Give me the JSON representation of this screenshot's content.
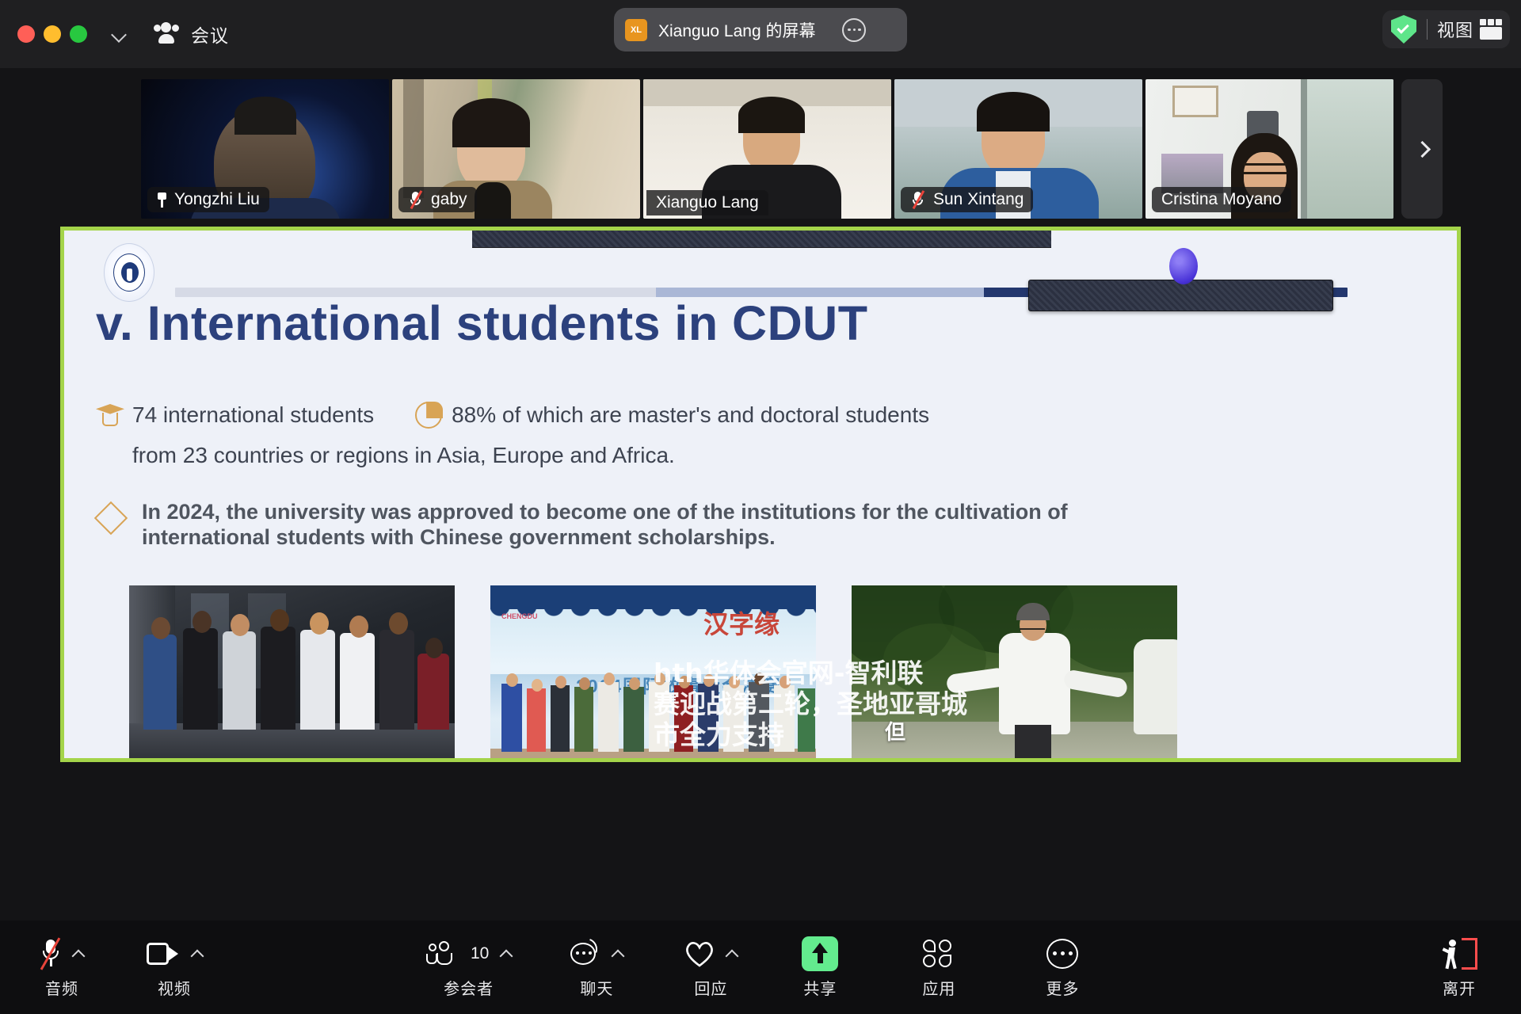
{
  "window": {
    "traffic_lights": [
      "close",
      "minimize",
      "maximize"
    ],
    "meeting_label": "会议",
    "chevron_icon": "chevron-down-icon",
    "participants_icon": "people-icon"
  },
  "share_banner": {
    "avatar_initials": "XL",
    "title": "Xianguo Lang 的屏幕",
    "more_icon": "ellipsis-circle-icon"
  },
  "top_right": {
    "security_icon": "shield-check-icon",
    "view_label": "视图",
    "layout_icon": "grid-layout-icon"
  },
  "filmstrip": {
    "next_icon": "chevron-right-icon",
    "participants": [
      {
        "name": "Yongzhi Liu",
        "status_icon": "pin-icon",
        "active": false
      },
      {
        "name": "gaby",
        "status_icon": "mic-muted-icon",
        "active": false
      },
      {
        "name": "Xianguo Lang",
        "status_icon": "none",
        "active": true
      },
      {
        "name": "Sun Xintang",
        "status_icon": "mic-muted-icon",
        "active": false
      },
      {
        "name": "Cristina Moyano",
        "status_icon": "none",
        "active": false
      }
    ]
  },
  "slide": {
    "title": "v. International students in CDUT",
    "stat_students_icon": "graduation-cap-icon",
    "stat_students": "74 international students",
    "stat_percent_icon": "pie-chart-icon",
    "stat_percent": "88% of which are  master's and doctoral students",
    "stat_line2": "from 23 countries or regions in Asia, Europe and Africa.",
    "paragraph_icon": "diamond-icon",
    "paragraph": "In 2024, the university was approved to become one of the institutions for the cultivation of international students  with Chinese government scholarships.",
    "logo_alt": "cdut-university-logo",
    "photo_captions": {
      "photo2_headline": "2024国际故事大会决赛",
      "photo2_calligraphy": "汉字缘",
      "photo2_city": "CHENGDU",
      "photo3_caption": "但"
    },
    "colors": {
      "title": "#2c417d",
      "accent": "#d8a456",
      "frame": "#a4d44a",
      "background": "#eef1f8"
    }
  },
  "watermark": {
    "line1": "hth华体会官网-智利联",
    "line2": "赛迎战第二轮，圣地亚哥城",
    "line3": "市全力支持"
  },
  "toolbar": {
    "items": [
      {
        "label": "音频",
        "icon": "microphone-muted-icon",
        "caret": true,
        "count": null
      },
      {
        "label": "视频",
        "icon": "camera-icon",
        "caret": true,
        "count": null
      },
      {
        "label": "参会者",
        "icon": "participants-icon",
        "caret": true,
        "count": "10"
      },
      {
        "label": "聊天",
        "icon": "chat-bubble-icon",
        "caret": true,
        "count": null
      },
      {
        "label": "回应",
        "icon": "heart-icon",
        "caret": true,
        "count": null
      },
      {
        "label": "共享",
        "icon": "share-screen-icon",
        "caret": false,
        "count": null
      },
      {
        "label": "应用",
        "icon": "apps-icon",
        "caret": false,
        "count": null
      },
      {
        "label": "更多",
        "icon": "more-ellipsis-icon",
        "caret": false,
        "count": null
      },
      {
        "label": "离开",
        "icon": "leave-meeting-icon",
        "caret": false,
        "count": null
      }
    ]
  }
}
